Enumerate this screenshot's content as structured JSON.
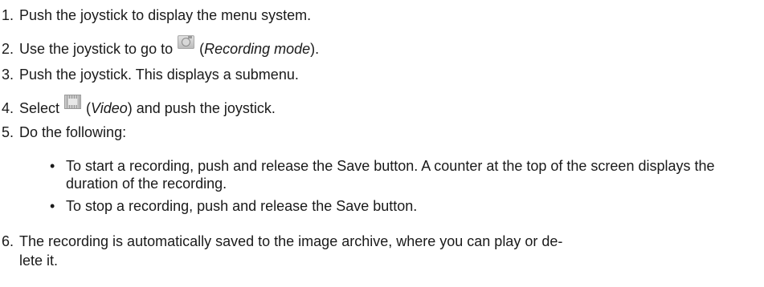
{
  "steps": [
    {
      "num": "1.",
      "text": "Push the joystick to display the menu system."
    },
    {
      "num": "2.",
      "before": "Use the joystick to go to",
      "em": "Recording mode",
      "paren_open": "(",
      "paren_close": ")."
    },
    {
      "num": "3.",
      "text": "Push the joystick. This displays a submenu."
    },
    {
      "num": "4.",
      "before": "Select",
      "em": "Video",
      "paren_open": "(",
      "after": ") and push the joystick."
    },
    {
      "num": "5.",
      "text": "Do the following:"
    },
    {
      "num": "6.",
      "line1": "The recording is automatically saved to the image archive, where you can play or de-",
      "line2": "lete it."
    }
  ],
  "bullets": [
    {
      "dot": "•",
      "text": "To start a recording, push and release the Save button. A counter at the top of the screen displays the duration of the recording."
    },
    {
      "dot": "•",
      "text": "To stop a recording, push and release the Save button."
    }
  ],
  "icons": {
    "recording_mode": "camera-icon",
    "video": "video-icon"
  }
}
